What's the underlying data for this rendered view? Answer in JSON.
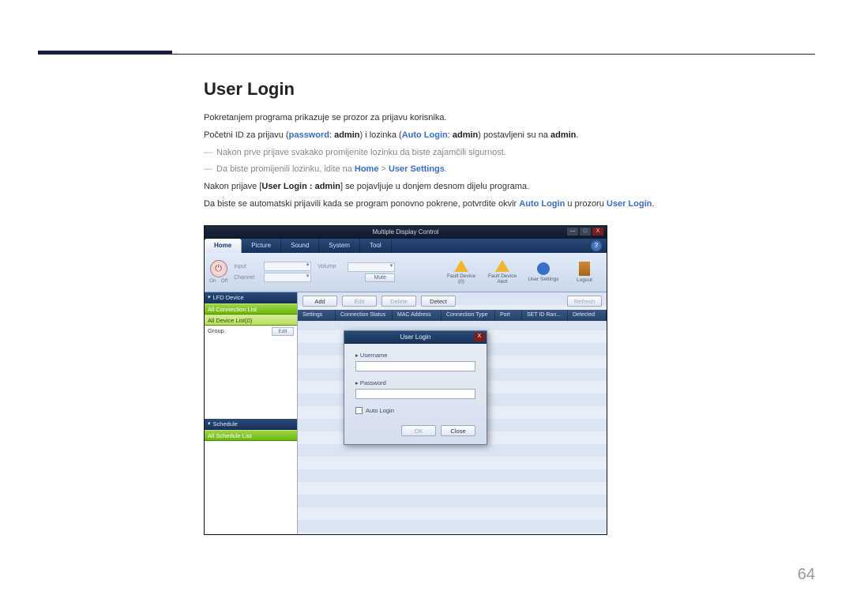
{
  "page_number": "64",
  "heading": "User Login",
  "doc": {
    "p1": "Pokretanjem programa prikazuje se prozor za prijavu korisnika.",
    "p2_a": "Početni ID za prijavu (",
    "p2_b": "password",
    "p2_c": ": ",
    "p2_d": "admin",
    "p2_e": ") i lozinka (",
    "p2_f": "Auto Login",
    "p2_g": ": ",
    "p2_h": "admin",
    "p2_i": ") postavljeni su na ",
    "p2_j": "admin",
    "p2_k": ".",
    "n1": "Nakon prve prijave svakako promijenite lozinku da biste zajamčili sigurnost.",
    "n2_a": "Da biste promijenili lozinku, idite na ",
    "n2_b": "Home",
    "n2_c": " > ",
    "n2_d": "User Settings",
    "n2_e": ".",
    "p3_a": "Nakon prijave [",
    "p3_b": "User Login : admin",
    "p3_c": "] se pojavljuje u donjem desnom dijelu programa.",
    "p4_a": "Da biste se automatski prijavili kada se program ponovno pokrene, potvrdite okvir ",
    "p4_b": "Auto Login",
    "p4_c": " u prozoru ",
    "p4_d": "User Login",
    "p4_e": "."
  },
  "app": {
    "title": "Multiple Display Control",
    "win": {
      "min": "—",
      "max": "□",
      "close": "X"
    },
    "tabs": {
      "home": "Home",
      "picture": "Picture",
      "sound": "Sound",
      "system": "System",
      "tool": "Tool"
    },
    "help": "?",
    "ribbon": {
      "on_label": "On",
      "off_label": "Off",
      "input": "Input",
      "channel": "Channel",
      "volume": "Volume",
      "mute": "Mute",
      "fault_device": "Fault Device (0)",
      "fault_alert": "Fault Device Alert",
      "user_settings": "User Settings",
      "logout": "Logout"
    },
    "sidebar": {
      "lfd": "LFD Device",
      "all_conn": "All Connection List",
      "all_device": "All Device List(0)",
      "group": "Group",
      "edit": "Edit",
      "schedule_h": "Schedule",
      "all_schedule": "All Schedule List"
    },
    "buttons": {
      "add": "Add",
      "edit": "Edit",
      "delete": "Delete",
      "detect": "Detect",
      "refresh": "Refresh"
    },
    "cols": {
      "settings": "Settings",
      "conn": "Connection Status",
      "mac": "MAC Address",
      "ctype": "Connection Type",
      "port": "Port",
      "setid": "SET ID Ran...",
      "det": "Detected"
    },
    "dialog": {
      "title": "User Login",
      "username": "Username",
      "password": "Password",
      "auto": "Auto Login",
      "ok": "OK",
      "close": "Close"
    }
  }
}
